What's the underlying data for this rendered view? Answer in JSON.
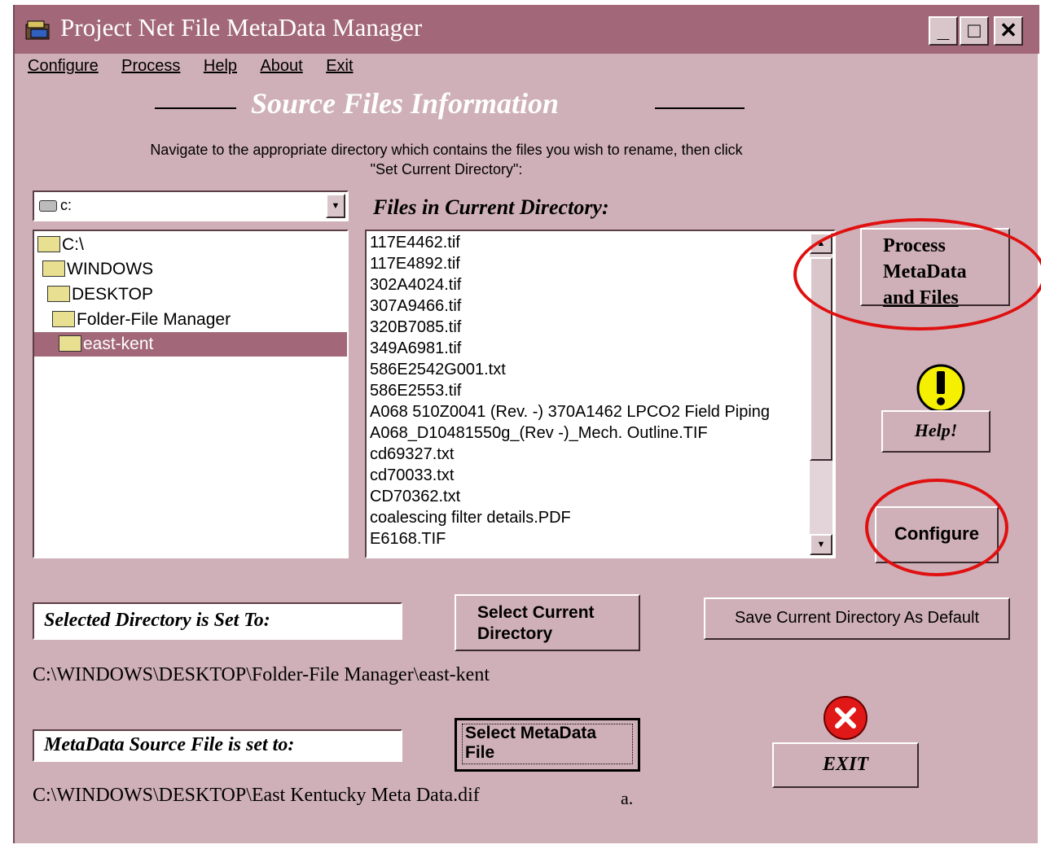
{
  "window": {
    "title": "Project Net File MetaData Manager",
    "buttons": {
      "minimize": "_",
      "maximize": "□",
      "close": "✕"
    }
  },
  "menu": [
    "Configure",
    "Process",
    "Help",
    "About",
    "Exit"
  ],
  "section_title": "Source Files Information",
  "instructions": {
    "line1": "Navigate to the appropriate directory which contains the files you wish to rename, then click",
    "line2": "\"Set Current Directory\":"
  },
  "drive": {
    "value": "c:"
  },
  "directories": [
    {
      "label": "C:\\",
      "selected": false
    },
    {
      "label": "WINDOWS",
      "selected": false
    },
    {
      "label": "DESKTOP",
      "selected": false
    },
    {
      "label": "Folder-File Manager",
      "selected": false
    },
    {
      "label": "east-kent",
      "selected": true
    }
  ],
  "files_label": "Files in Current Directory:",
  "files": [
    "117E4462.tif",
    "117E4892.tif",
    "302A4024.tif",
    "307A9466.tif",
    "320B7085.tif",
    "349A6981.tif",
    "586E2542G001.txt",
    "586E2553.tif",
    "A068 510Z0041 (Rev. -) 370A1462  LPCO2 Field Piping",
    "A068_D10481550g_(Rev -)_Mech. Outline.TIF",
    "cd69327.txt",
    "cd70033.txt",
    "CD70362.txt",
    "coalescing filter details.PDF",
    "E6168.TIF"
  ],
  "buttons": {
    "process_line1": "Process",
    "process_line2": "MetaData",
    "process_line3": "and Files",
    "help": "Help!",
    "configure": "Configure",
    "select_dir_line1": "Select Current",
    "select_dir_line2": "Directory",
    "save_default": "Save Current Directory As Default",
    "select_meta_line1": "Select MetaData",
    "select_meta_line2": "File",
    "exit": "EXIT"
  },
  "selected_dir_label": "Selected Directory is Set To:",
  "selected_dir_value": "C:\\WINDOWS\\DESKTOP\\Folder-File Manager\\east-kent",
  "meta_label": "MetaData Source File is set to:",
  "meta_value": "C:\\WINDOWS\\DESKTOP\\East Kentucky Meta Data.dif",
  "stray_text": "a.",
  "colors": {
    "title_bar": "#a26879",
    "background": "#cfb0b8",
    "highlight_ring": "#e01010"
  }
}
